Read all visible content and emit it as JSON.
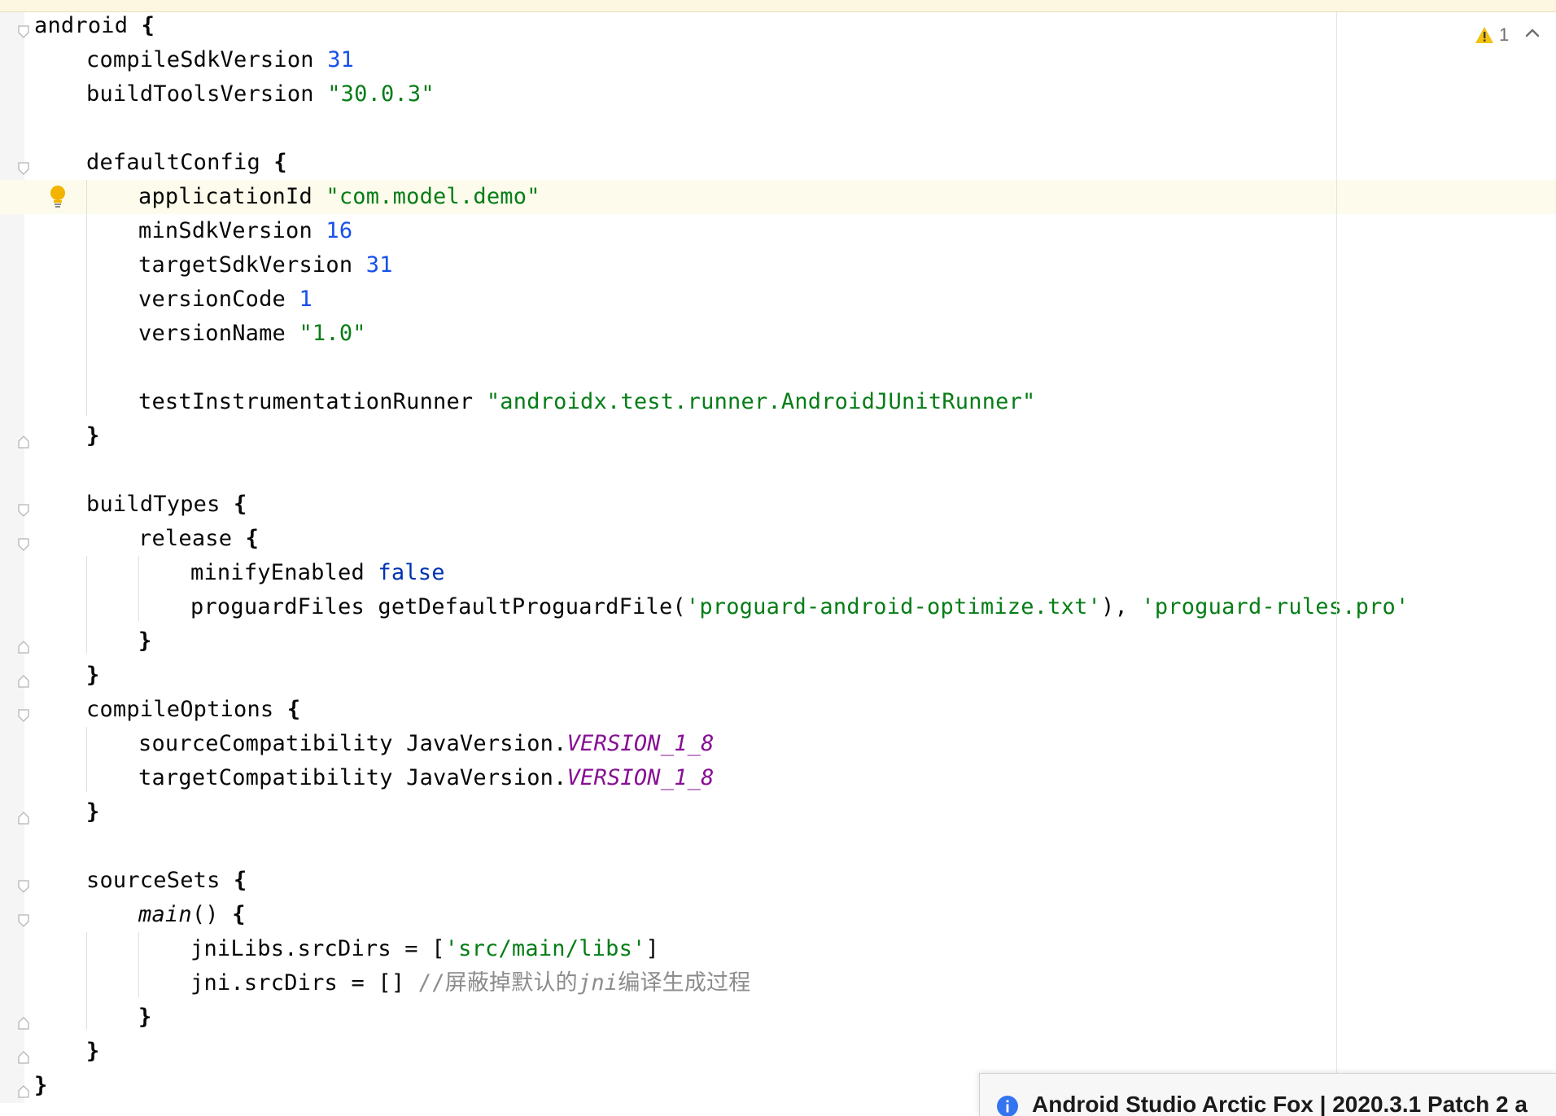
{
  "colors": {
    "keyword": "#0033b3",
    "number": "#1750eb",
    "string": "#067d17",
    "constant": "#871094",
    "comment": "#8c8c8c",
    "text": "#080808",
    "current_line": "#fdfbeb",
    "warning": "#f2c20f",
    "info": "#3574f0"
  },
  "status": {
    "warning_count": "1",
    "warning_icon": "warning-icon",
    "nav_icon": "chevron-up-icon"
  },
  "code": {
    "l1": {
      "a": "android ",
      "b": "{"
    },
    "l2": {
      "a": "compileSdkVersion ",
      "b": "31"
    },
    "l3": {
      "a": "buildToolsVersion ",
      "b": "\"30.0.3\""
    },
    "l5": {
      "a": "defaultConfig ",
      "b": "{"
    },
    "l6": {
      "a": "applicationId ",
      "b": "\"com.model.demo\""
    },
    "l7": {
      "a": "minSdkVersion ",
      "b": "16"
    },
    "l8": {
      "a": "targetSdkVersion ",
      "b": "31"
    },
    "l9": {
      "a": "versionCode ",
      "b": "1"
    },
    "l10": {
      "a": "versionName ",
      "b": "\"1.0\""
    },
    "l12": {
      "a": "testInstrumentationRunner ",
      "b": "\"androidx.test.runner.AndroidJUnitRunner\""
    },
    "l13": {
      "a": "}"
    },
    "l15": {
      "a": "buildTypes ",
      "b": "{"
    },
    "l16": {
      "a": "release ",
      "b": "{"
    },
    "l17": {
      "a": "minifyEnabled ",
      "b": "false"
    },
    "l18": {
      "a": "proguardFiles getDefaultProguardFile(",
      "b": "'proguard-android-optimize.txt'",
      "c": "), ",
      "d": "'proguard-rules.pro'"
    },
    "l19": {
      "a": "}"
    },
    "l20": {
      "a": "}"
    },
    "l21": {
      "a": "compileOptions ",
      "b": "{"
    },
    "l22": {
      "a": "sourceCompatibility JavaVersion.",
      "b": "VERSION_1_8"
    },
    "l23": {
      "a": "targetCompatibility JavaVersion.",
      "b": "VERSION_1_8"
    },
    "l24": {
      "a": "}"
    },
    "l26": {
      "a": "sourceSets ",
      "b": "{"
    },
    "l27": {
      "a": "main",
      "b": "() ",
      "c": "{"
    },
    "l28": {
      "a": "jniLibs.srcDirs = [",
      "b": "'src/main/libs'",
      "c": "]"
    },
    "l29": {
      "a": "jni.srcDirs = [] ",
      "b": "//屏蔽掉默认的",
      "c": "jni",
      "d": "编译生成过程"
    },
    "l30": {
      "a": "}"
    },
    "l31": {
      "a": "}"
    },
    "l32": {
      "a": "}"
    }
  },
  "notification": {
    "icon": "info-icon",
    "text": "Android Studio Arctic Fox | 2020.3.1 Patch 2 a"
  }
}
